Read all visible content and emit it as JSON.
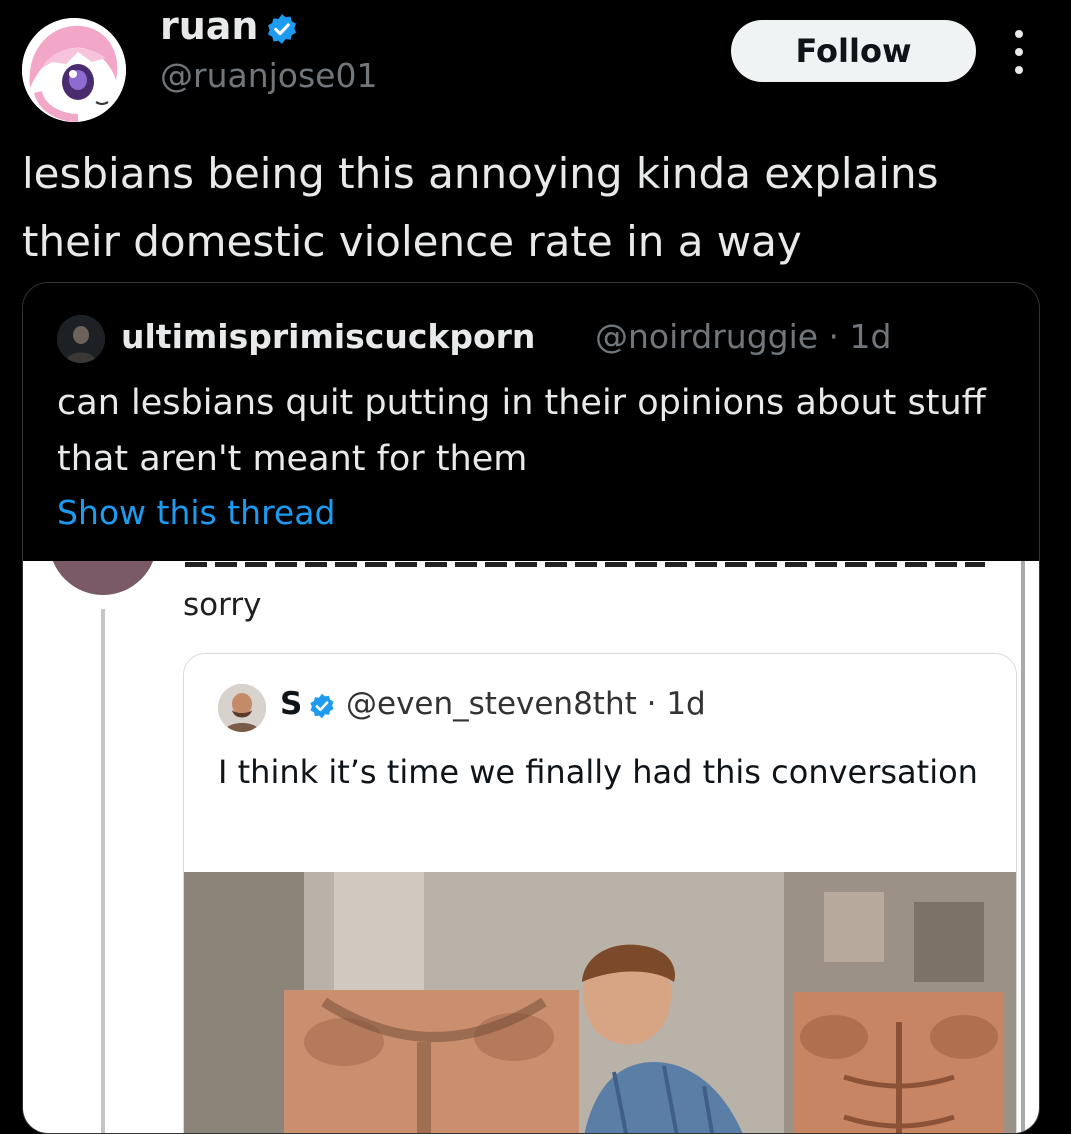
{
  "post": {
    "author_name": "ruan",
    "author_handle": "@ruanjose01",
    "follow_label": "Follow",
    "text": "lesbians being this annoying kinda explains their domestic violence rate in a way"
  },
  "quote": {
    "author_name": "ultimisprimiscuckporn",
    "author_handle": "@noirdruggie · 1d",
    "text": "can lesbians quit putting in their opinions about stuff that aren't meant for them",
    "show_thread": "Show this thread"
  },
  "screenshot": {
    "reply_text": "sorry",
    "inner_author_name": "S",
    "inner_author_handle": "@even_steven8tht · 1d",
    "inner_text": "I think it’s time we finally had this conversation"
  },
  "colors": {
    "background": "#000000",
    "text": "#e7e9ea",
    "secondary": "#71767b",
    "link": "#1d9bf0",
    "verified": "#1d9bf0",
    "follow_bg": "#eff3f4"
  },
  "icons": [
    "verified-badge-icon",
    "more-options-icon"
  ]
}
